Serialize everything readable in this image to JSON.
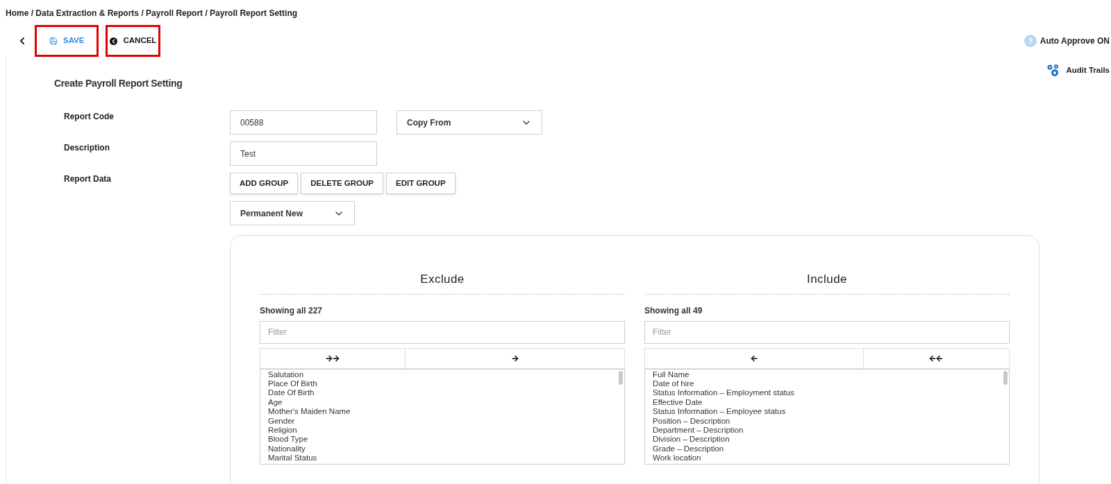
{
  "breadcrumb": "Home / Data Extraction & Reports / Payroll Report / Payroll Report Setting",
  "toolbar": {
    "help": "?",
    "actions": [
      {
        "kind": "save",
        "label": "SAVE",
        "highlighted": true
      },
      {
        "kind": "cancel",
        "label": "CANCEL",
        "highlighted": true
      }
    ],
    "auto_approve": "Auto Approve ON",
    "audit_trails": "Audit Trails"
  },
  "form": {
    "title": "Create Payroll Report Setting",
    "report_code": {
      "label": "Report Code",
      "value": "00588",
      "copy_from": "Copy From"
    },
    "description": {
      "label": "Description",
      "value": "Test"
    },
    "report_data": {
      "label": "Report Data",
      "buttons": [
        "ADD GROUP",
        "DELETE GROUP",
        "EDIT GROUP"
      ],
      "group": "Permanent New"
    }
  },
  "lists": [
    {
      "title": "Exclude",
      "count": "Showing all 227",
      "placeholder": "Filter",
      "moves": [
        {
          "kind": "move_all_right"
        },
        {
          "kind": "move_right"
        }
      ],
      "items": [
        "Salutation",
        "Place Of Birth",
        "Date Of Birth",
        "Age",
        "Mother's Maiden Name",
        "Gender",
        "Religion",
        "Blood Type",
        "Nationality",
        "Marital Status"
      ]
    },
    {
      "title": "Include",
      "count": "Showing all 49",
      "placeholder": "Filter",
      "moves": [
        {
          "kind": "move_left"
        },
        {
          "kind": "move_all_left"
        }
      ],
      "items": [
        "Full Name",
        "Date of hire",
        "Status Information – Employment status",
        "Effective Date",
        "Status Information – Employee status",
        "Position – Description",
        "Department – Description",
        "Division – Description",
        "Grade – Description",
        "Work location"
      ]
    }
  ]
}
